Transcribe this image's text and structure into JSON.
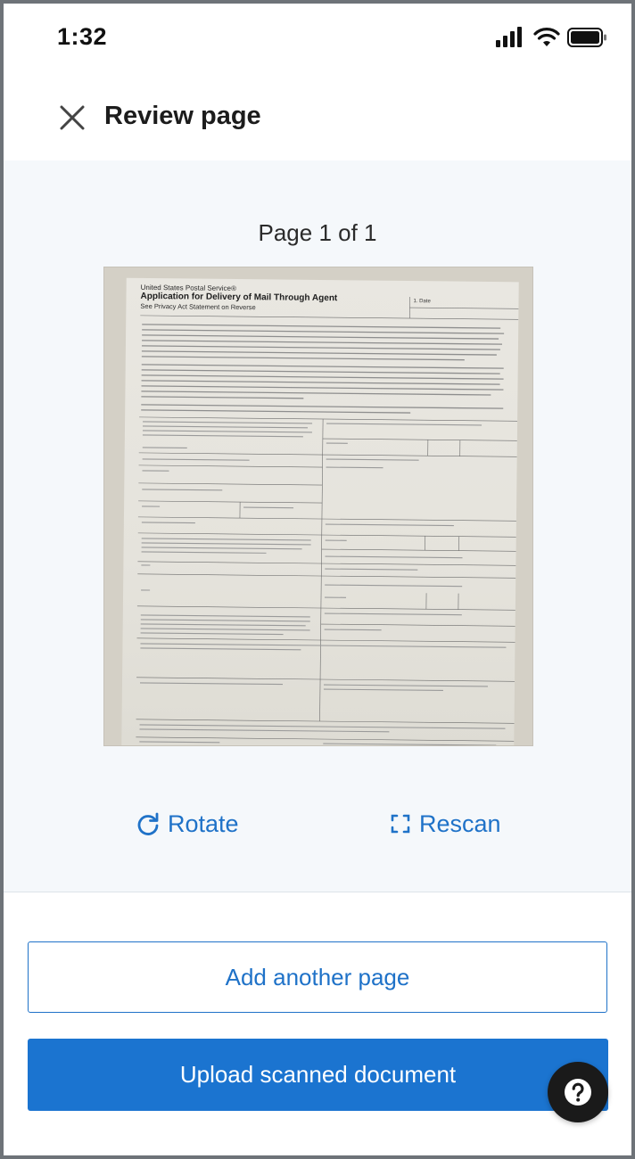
{
  "status_bar": {
    "time": "1:32"
  },
  "header": {
    "title": "Review page"
  },
  "review": {
    "page_counter": "Page 1 of 1",
    "document": {
      "header_line1": "United States Postal Service®",
      "header_line2": "Application for Delivery of Mail Through Agent",
      "header_line3": "See Privacy Act Statement on Reverse",
      "date_label": "1. Date"
    },
    "rotate_label": "Rotate",
    "rescan_label": "Rescan"
  },
  "actions": {
    "add_page_label": "Add another page",
    "upload_label": "Upload scanned document"
  },
  "colors": {
    "accent": "#1f72c8",
    "primary_button": "#1b74d0",
    "content_bg": "#f5f8fb"
  },
  "icons": [
    "close-icon",
    "rotate-icon",
    "rescan-icon",
    "help-icon",
    "signal-icon",
    "wifi-icon",
    "battery-icon"
  ]
}
